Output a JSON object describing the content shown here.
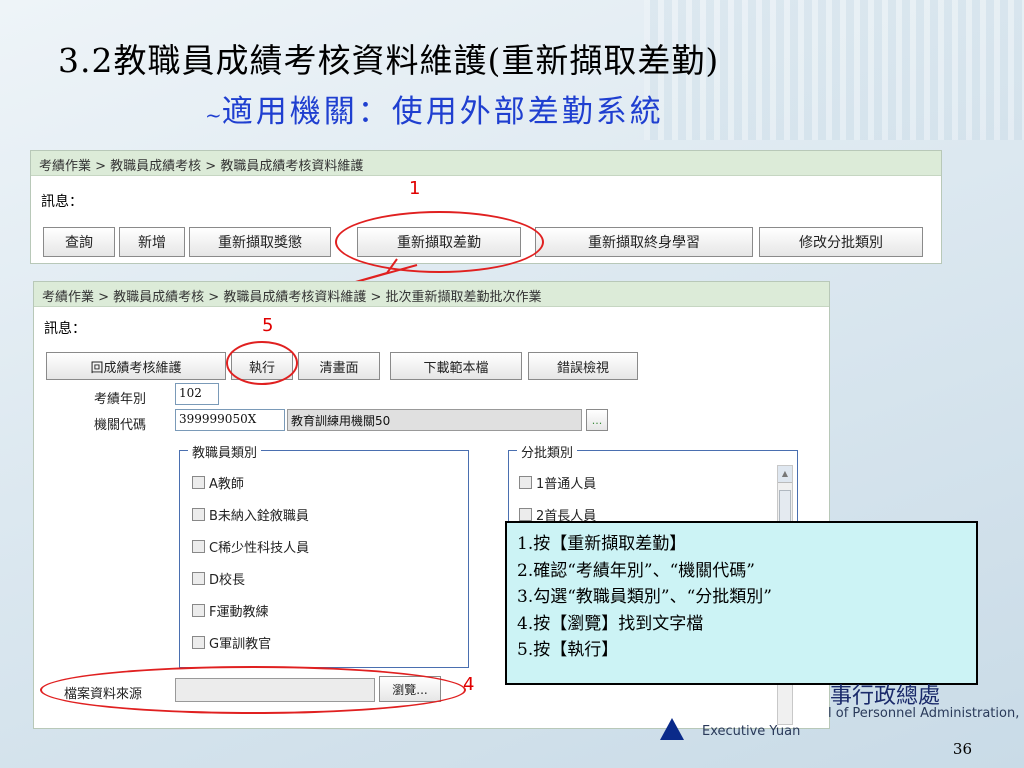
{
  "slide": {
    "title_line1": "3.2教職員成績考核資料維護(重新擷取差勤)",
    "title_line2_prefix": "~",
    "title_line2": "適用機關：使用外部差勤系統",
    "page_number": "36"
  },
  "panel_top": {
    "breadcrumb": "考績作業 > 教職員成績考核 > 教職員成績考核資料維護",
    "message_label": "訊息：",
    "buttons": {
      "query": "查詢",
      "add": "新增",
      "refetch_rewards": "重新擷取獎懲",
      "refetch_attendance": "重新擷取差勤",
      "refetch_lifelong": "重新擷取終身學習",
      "edit_batch": "修改分批類別"
    },
    "callout_1": "1"
  },
  "panel_bottom": {
    "breadcrumb": "考績作業 > 教職員成績考核 > 教職員成績考核資料維護 > 批次重新擷取差勤批次作業",
    "message_label": "訊息：",
    "callout_5": "5",
    "callout_4": "4",
    "buttons": {
      "back": "回成績考核維護",
      "execute": "執行",
      "clear": "清畫面",
      "download_template": "下載範本檔",
      "error_view": "錯誤檢視"
    },
    "year_label": "考績年別",
    "year_value": "102",
    "agency_label": "機關代碼",
    "agency_code": "399999050X",
    "agency_name": "教育訓練用機關50",
    "lookup_button": "...",
    "staff_category": {
      "legend": "教職員類別",
      "items": [
        "A教師",
        "B未納入銓敘職員",
        "C稀少性科技人員",
        "D校長",
        "F運動教練",
        "G軍訓教官"
      ]
    },
    "batch_category": {
      "legend": "分批類別",
      "items": [
        "1普通人員",
        "2首長人員"
      ]
    },
    "file_source_label": "檔案資料來源",
    "file_value": "",
    "browse_button": "瀏覽..."
  },
  "instructions": [
    "1.按【重新擷取差勤】",
    "2.確認“考績年別”、“機關代碼”",
    "3.勾選“教職員類別”、“分批類別”",
    "4.按【瀏覽】找到文字檔",
    "5.按【執行】"
  ],
  "branding": {
    "chinese_fragment": "事行政總處",
    "english_line1": "l of Personnel Administration,",
    "english_line2": "Executive Yuan"
  },
  "colors": {
    "highlight_red": "#e02020",
    "title_blue": "#1f3fd0",
    "breadcrumb_bg": "#dcebd8",
    "instruction_bg": "#ccf3f5"
  }
}
